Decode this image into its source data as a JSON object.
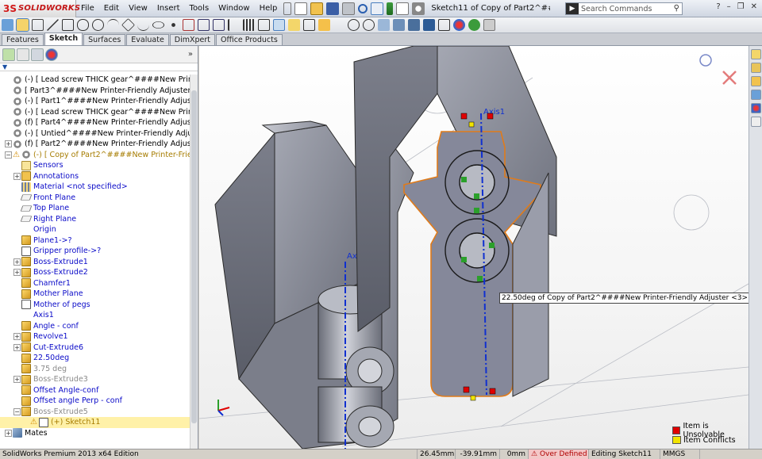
{
  "app": {
    "brand": "SOLIDWORKS",
    "brand_mark": "3S",
    "document_title": "Sketch11 of Copy of Part2^####Ne...",
    "search_placeholder": "Search Commands"
  },
  "menu": [
    "File",
    "Edit",
    "View",
    "Insert",
    "Tools",
    "Window",
    "Help"
  ],
  "tabs": [
    {
      "label": "Features",
      "active": false
    },
    {
      "label": "Sketch",
      "active": true
    },
    {
      "label": "Surfaces",
      "active": false
    },
    {
      "label": "Evaluate",
      "active": false
    },
    {
      "label": "DimXpert",
      "active": false
    },
    {
      "label": "Office Products",
      "active": false
    }
  ],
  "tree": [
    {
      "label": "(-) [ Lead screw THICK gear^####New Printer-Frien",
      "level": 0,
      "exp": "none",
      "icon": "gear",
      "style": ""
    },
    {
      "label": "[ Part3^####New Printer-Friendly Adjuster ]<1>->",
      "level": 0,
      "exp": "none",
      "icon": "gear",
      "style": ""
    },
    {
      "label": "(-) [ Part1^####New Printer-Friendly Adjuster ]<3>",
      "level": 0,
      "exp": "none",
      "icon": "gear",
      "style": ""
    },
    {
      "label": "(-) [ Lead screw THICK gear^####New Printer-Frien",
      "level": 0,
      "exp": "none",
      "icon": "gear",
      "style": ""
    },
    {
      "label": "(f) [ Part4^####New Printer-Friendly Adjuster ]<1>",
      "level": 0,
      "exp": "none",
      "icon": "gear",
      "style": ""
    },
    {
      "label": "(-) [ Untied^####New Printer-Friendly Adjuster ]<2",
      "level": 0,
      "exp": "none",
      "icon": "gear",
      "style": ""
    },
    {
      "label": "(f) [ Part2^####New Printer-Friendly Adjuster ]<1>",
      "level": 0,
      "exp": "plus",
      "icon": "gear",
      "style": ""
    },
    {
      "label": "(-) [ Copy of Part2^####New Printer-Friendly Ad",
      "level": 0,
      "exp": "minus",
      "icon": "gear",
      "style": "warn",
      "warning": true
    },
    {
      "label": "Sensors",
      "level": 1,
      "exp": "none",
      "icon": "sensor",
      "style": "blue"
    },
    {
      "label": "Annotations",
      "level": 1,
      "exp": "plus",
      "icon": "annot",
      "style": "blue"
    },
    {
      "label": "Material <not specified>",
      "level": 1,
      "exp": "none",
      "icon": "material",
      "style": "blue"
    },
    {
      "label": "Front Plane",
      "level": 1,
      "exp": "none",
      "icon": "plane",
      "style": "blue"
    },
    {
      "label": "Top Plane",
      "level": 1,
      "exp": "none",
      "icon": "plane",
      "style": "blue"
    },
    {
      "label": "Right Plane",
      "level": 1,
      "exp": "none",
      "icon": "plane",
      "style": "blue"
    },
    {
      "label": "Origin",
      "level": 1,
      "exp": "none",
      "icon": "origin",
      "style": "blue"
    },
    {
      "label": "Plane1->?",
      "level": 1,
      "exp": "none",
      "icon": "feat",
      "style": "blue"
    },
    {
      "label": "Gripper profile->?",
      "level": 1,
      "exp": "none",
      "icon": "sketch",
      "style": "blue"
    },
    {
      "label": "Boss-Extrude1",
      "level": 1,
      "exp": "plus",
      "icon": "feat",
      "style": "blue"
    },
    {
      "label": "Boss-Extrude2",
      "level": 1,
      "exp": "plus",
      "icon": "feat",
      "style": "blue"
    },
    {
      "label": "Chamfer1",
      "level": 1,
      "exp": "none",
      "icon": "feat",
      "style": "blue"
    },
    {
      "label": "Mother Plane",
      "level": 1,
      "exp": "none",
      "icon": "feat",
      "style": "blue"
    },
    {
      "label": "Mother of pegs",
      "level": 1,
      "exp": "none",
      "icon": "sketch",
      "style": "blue"
    },
    {
      "label": "Axis1",
      "level": 1,
      "exp": "none",
      "icon": "axis",
      "style": "blue"
    },
    {
      "label": "Angle - conf",
      "level": 1,
      "exp": "none",
      "icon": "feat",
      "style": "blue"
    },
    {
      "label": "Revolve1",
      "level": 1,
      "exp": "plus",
      "icon": "feat",
      "style": "blue"
    },
    {
      "label": "Cut-Extrude6",
      "level": 1,
      "exp": "plus",
      "icon": "feat",
      "style": "blue"
    },
    {
      "label": "22.50deg",
      "level": 1,
      "exp": "none",
      "icon": "feat",
      "style": "blue"
    },
    {
      "label": "3.75 deg",
      "level": 1,
      "exp": "none",
      "icon": "feat",
      "style": "gray"
    },
    {
      "label": "Boss-Extrude3",
      "level": 1,
      "exp": "plus",
      "icon": "feat",
      "style": "gray"
    },
    {
      "label": "Offset Angle-conf",
      "level": 1,
      "exp": "none",
      "icon": "feat",
      "style": "blue"
    },
    {
      "label": "Offset angle Perp - conf",
      "level": 1,
      "exp": "none",
      "icon": "feat",
      "style": "blue"
    },
    {
      "label": "Boss-Extrude5",
      "level": 1,
      "exp": "minus",
      "icon": "feat",
      "style": "gray"
    },
    {
      "label": "(+) Sketch11",
      "level": 2,
      "exp": "none",
      "icon": "sketch",
      "style": "warn",
      "warning": true,
      "selected": true
    },
    {
      "label": "Mates",
      "level": 0,
      "exp": "plus",
      "icon": "mates",
      "style": ""
    }
  ],
  "viewport": {
    "callout": "22.50deg of Copy of Part2^####New Printer-Friendly Adjuster <3>",
    "axis_labels": [
      "Axis1",
      "Axis1"
    ],
    "legend": [
      {
        "label": "Item is Unsolvable",
        "color": "#e00000"
      },
      {
        "label": "Item Conflicts",
        "color": "#f2e400"
      }
    ]
  },
  "status": {
    "edition": "SolidWorks Premium 2013 x64 Edition",
    "x": "26.45mm",
    "y": "-39.91mm",
    "z": "0mm",
    "state": "Over Defined",
    "mode": "Editing Sketch11",
    "units": "MMGS"
  },
  "colors": {
    "part_fill": "#8a8d99",
    "part_edge": "#2a2a2a",
    "sketch_outline": "#e07b1a",
    "axis": "#1030d0",
    "accent": "#c41616"
  }
}
